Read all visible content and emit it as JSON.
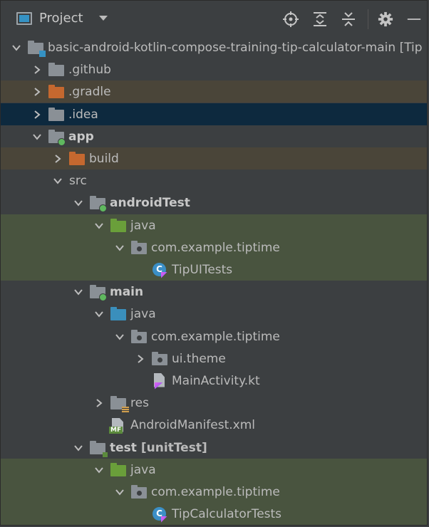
{
  "panel": {
    "title": "Project"
  },
  "tree": [
    {
      "label": "basic-android-kotlin-compose-training-tip-calculator-main [Tip",
      "level": 0,
      "chevron": "down",
      "icon": "module-folder",
      "bg": ""
    },
    {
      "label": ".github",
      "level": 1,
      "chevron": "right",
      "icon": "folder-grey",
      "bg": ""
    },
    {
      "label": ".gradle",
      "level": 1,
      "chevron": "right",
      "icon": "folder-orange",
      "bg": "orange"
    },
    {
      "label": ".idea",
      "level": 1,
      "chevron": "right",
      "icon": "folder-grey",
      "bg": "blue"
    },
    {
      "label": "app",
      "level": 1,
      "chevron": "down",
      "icon": "folder-module-dot",
      "bg": "",
      "bold": true
    },
    {
      "label": "build",
      "level": 2,
      "chevron": "right",
      "icon": "folder-orange",
      "bg": "orange"
    },
    {
      "label": "src",
      "level": 2,
      "chevron": "down",
      "icon": "none",
      "bg": ""
    },
    {
      "label": "androidTest",
      "level": 3,
      "chevron": "down",
      "icon": "folder-module-dot",
      "bg": "",
      "bold": true
    },
    {
      "label": "java",
      "level": 4,
      "chevron": "down",
      "icon": "folder-green",
      "bg": "green"
    },
    {
      "label": "com.example.tiptime",
      "level": 5,
      "chevron": "down",
      "icon": "package",
      "bg": "green"
    },
    {
      "label": "TipUITests",
      "level": 6,
      "chevron": "none",
      "icon": "kotlin-class",
      "bg": "green"
    },
    {
      "label": "main",
      "level": 3,
      "chevron": "down",
      "icon": "folder-module-dot",
      "bg": "",
      "bold": true
    },
    {
      "label": "java",
      "level": 4,
      "chevron": "down",
      "icon": "folder-blue",
      "bg": ""
    },
    {
      "label": "com.example.tiptime",
      "level": 5,
      "chevron": "down",
      "icon": "package",
      "bg": ""
    },
    {
      "label": "ui.theme",
      "level": 6,
      "chevron": "right",
      "icon": "package",
      "bg": ""
    },
    {
      "label": "MainActivity.kt",
      "level": 6,
      "chevron": "none",
      "icon": "kotlin-file",
      "bg": ""
    },
    {
      "label": "res",
      "level": 4,
      "chevron": "right",
      "icon": "folder-res",
      "bg": ""
    },
    {
      "label": "AndroidManifest.xml",
      "level": 4,
      "chevron": "none",
      "icon": "manifest",
      "bg": ""
    },
    {
      "label": "test",
      "level": 3,
      "chevron": "down",
      "icon": "folder-module",
      "bg": "",
      "bold": true,
      "extra": "[unitTest]"
    },
    {
      "label": "java",
      "level": 4,
      "chevron": "down",
      "icon": "folder-green",
      "bg": "green"
    },
    {
      "label": "com.example.tiptime",
      "level": 5,
      "chevron": "down",
      "icon": "package",
      "bg": "green"
    },
    {
      "label": "TipCalculatorTests",
      "level": 6,
      "chevron": "none",
      "icon": "kotlin-class",
      "bg": "green"
    }
  ]
}
